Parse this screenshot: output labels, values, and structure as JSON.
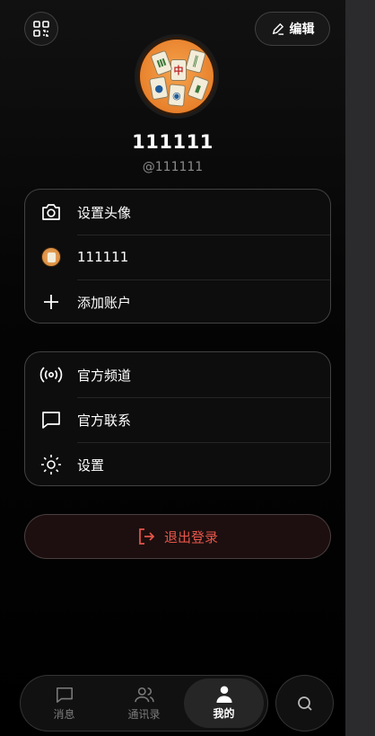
{
  "header": {
    "edit_label": "编辑"
  },
  "profile": {
    "name": "111111",
    "handle": "@111111"
  },
  "account_card": {
    "items": [
      {
        "label": "设置头像",
        "icon": "camera-icon"
      },
      {
        "label": "111111",
        "icon": "avatar"
      },
      {
        "label": "添加账户",
        "icon": "plus-icon"
      }
    ]
  },
  "menu_card": {
    "items": [
      {
        "label": "官方频道",
        "icon": "broadcast-icon"
      },
      {
        "label": "官方联系",
        "icon": "message-icon"
      },
      {
        "label": "设置",
        "icon": "sun-icon"
      }
    ]
  },
  "logout": {
    "label": "退出登录",
    "color": "#e4564a"
  },
  "tabbar": {
    "tabs": [
      {
        "label": "消息",
        "icon": "message-icon",
        "active": false
      },
      {
        "label": "通讯录",
        "icon": "contacts-icon",
        "active": false
      },
      {
        "label": "我的",
        "icon": "user-icon",
        "active": true
      }
    ],
    "search_icon": "search-icon"
  }
}
